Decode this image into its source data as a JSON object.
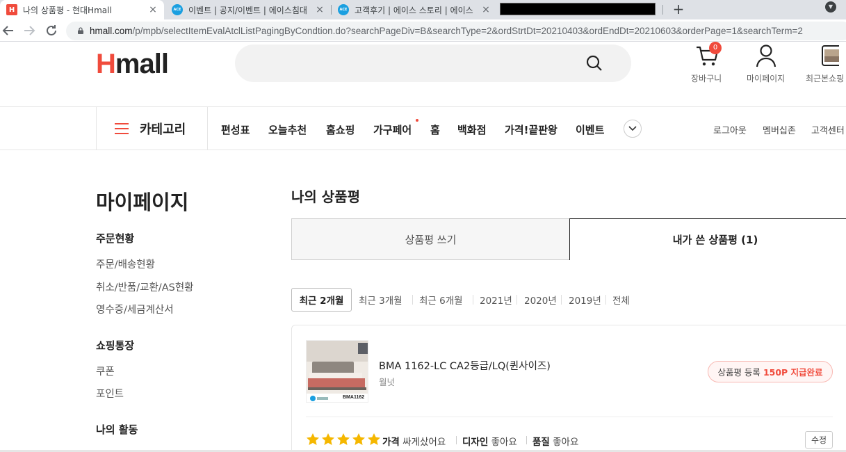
{
  "browser": {
    "tabs": [
      {
        "favicon": "H",
        "favicon_color": "#f04b3c",
        "title": "나의 상품평 - 현대Hmall",
        "active": true
      },
      {
        "favicon": "ACE",
        "favicon_color": "#1a9fe0",
        "title": "이벤트 | 공지/이벤트 | 에이스침대",
        "active": false
      },
      {
        "favicon": "ACE",
        "favicon_color": "#1a9fe0",
        "title": "고객후기 | 에이스 스토리 | 에이스",
        "active": false
      }
    ],
    "close_glyph": "×",
    "new_tab_glyph": "+",
    "url_host": "hmall.com",
    "url_path": "/p/mpb/selectItemEvalAtclListPagingByCondtion.do?searchPageDiv=B&searchType=2&ordStrtDt=20210403&ordEndDt=20210603&orderPage=1&searchTerm=2"
  },
  "header": {
    "logo_h": "H",
    "logo_rest": "mall",
    "search_placeholder": "",
    "cart_label": "장바구니",
    "cart_count": "0",
    "mypage_label": "마이페이지",
    "recent_label": "최근본쇼핑"
  },
  "gnb": {
    "category_label": "카테고리",
    "menu": [
      "편성표",
      "오늘추천",
      "홈쇼핑",
      "가구페어",
      "홈",
      "백화점",
      "가격!끝판왕",
      "이벤트"
    ],
    "links": [
      "로그아웃",
      "멤버십존",
      "고객센터"
    ]
  },
  "sidebar": {
    "title": "마이페이지",
    "sections": [
      {
        "heading": "주문현황",
        "items": [
          "주문/배송현황",
          "취소/반품/교환/AS현황",
          "영수증/세금계산서"
        ]
      },
      {
        "heading": "쇼핑통장",
        "items": [
          "쿠폰",
          "포인트"
        ]
      },
      {
        "heading": "나의 활동",
        "items": []
      }
    ]
  },
  "main": {
    "title": "나의 상품평",
    "tabs": [
      "상품평 쓰기",
      "내가 쓴 상품평 (1)"
    ],
    "periods": [
      "최근 2개월",
      "최근 3개월",
      "최근 6개월",
      "2021년",
      "2020년",
      "2019년",
      "전체"
    ],
    "review": {
      "product_name": "BMA 1162-LC CA2등급/LQ(퀸사이즈)",
      "brand": "월넛",
      "thumb_label": "BMA1162",
      "status_prefix": "상품평 등록",
      "status_point": "150P 지급완료",
      "rating": 5,
      "aspects": [
        {
          "label": "가격",
          "value": "싸게샀어요"
        },
        {
          "label": "디자인",
          "value": "좋아요"
        },
        {
          "label": "품질",
          "value": "좋아요"
        }
      ],
      "edit_label": "수정"
    }
  }
}
